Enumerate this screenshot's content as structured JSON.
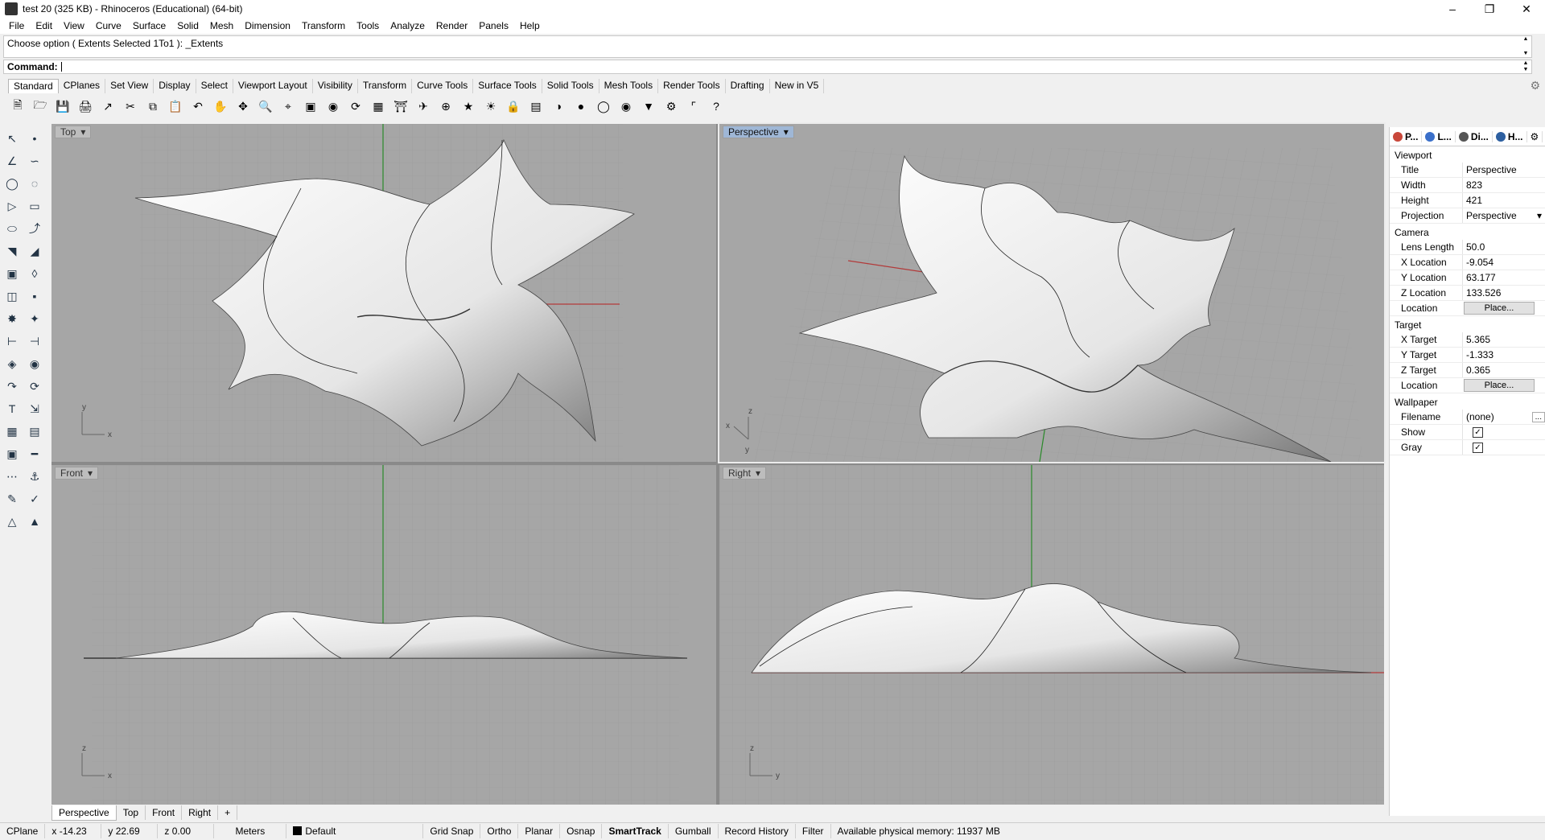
{
  "window": {
    "title": "test 20 (325 KB) - Rhinoceros (Educational) (64-bit)"
  },
  "menu": [
    "File",
    "Edit",
    "View",
    "Curve",
    "Surface",
    "Solid",
    "Mesh",
    "Dimension",
    "Transform",
    "Tools",
    "Analyze",
    "Render",
    "Panels",
    "Help"
  ],
  "command_history": "Choose option ( Extents  Selected  1To1 ): _Extents",
  "command_prompt": "Command:",
  "toolbar_tabs": [
    "Standard",
    "CPlanes",
    "Set View",
    "Display",
    "Select",
    "Viewport Layout",
    "Visibility",
    "Transform",
    "Curve Tools",
    "Surface Tools",
    "Solid Tools",
    "Mesh Tools",
    "Render Tools",
    "Drafting",
    "New in V5"
  ],
  "viewports": {
    "top": "Top",
    "perspective": "Perspective",
    "front": "Front",
    "right": "Right"
  },
  "axis_labels": {
    "x": "x",
    "y": "y",
    "z": "z"
  },
  "viewport_tabs": [
    "Perspective",
    "Top",
    "Front",
    "Right",
    "+"
  ],
  "panel": {
    "tabs": [
      "P...",
      "L...",
      "Di...",
      "H..."
    ],
    "viewport_section": "Viewport",
    "title_k": "Title",
    "title_v": "Perspective",
    "width_k": "Width",
    "width_v": "823",
    "height_k": "Height",
    "height_v": "421",
    "projection_k": "Projection",
    "projection_v": "Perspective",
    "camera_section": "Camera",
    "lens_k": "Lens Length",
    "lens_v": "50.0",
    "xloc_k": "X Location",
    "xloc_v": "-9.054",
    "yloc_k": "Y Location",
    "yloc_v": "63.177",
    "zloc_k": "Z Location",
    "zloc_v": "133.526",
    "loc_k": "Location",
    "place_label": "Place...",
    "target_section": "Target",
    "xt_k": "X Target",
    "xt_v": "5.365",
    "yt_k": "Y Target",
    "yt_v": "-1.333",
    "zt_k": "Z Target",
    "zt_v": "0.365",
    "wallpaper_section": "Wallpaper",
    "filename_k": "Filename",
    "filename_v": "(none)",
    "show_k": "Show",
    "gray_k": "Gray"
  },
  "status": {
    "cplane": "CPlane",
    "x": "x -14.23",
    "y": "y 22.69",
    "z": "z 0.00",
    "units": "Meters",
    "layer": "Default",
    "grid_snap": "Grid Snap",
    "ortho": "Ortho",
    "planar": "Planar",
    "osnap": "Osnap",
    "smarttrack": "SmartTrack",
    "gumball": "Gumball",
    "record_history": "Record History",
    "filter": "Filter",
    "memory": "Available physical memory: 11937 MB"
  }
}
